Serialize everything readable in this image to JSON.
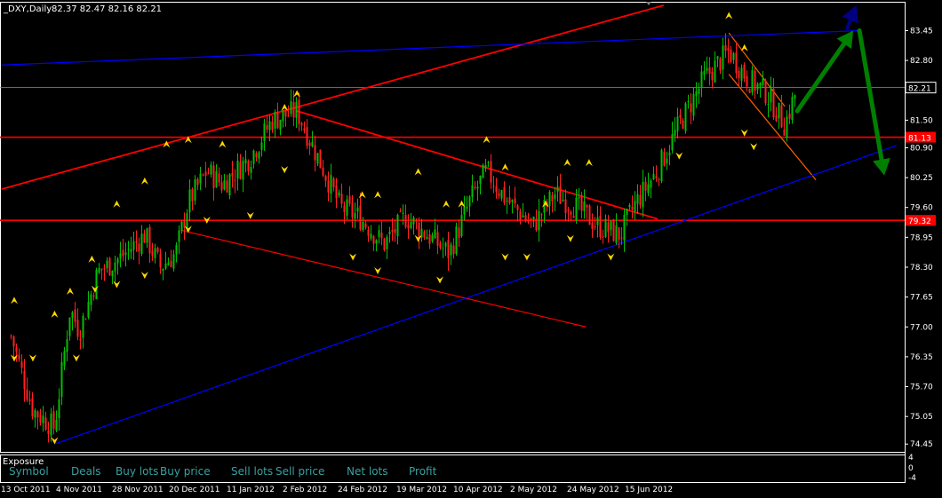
{
  "window": {
    "symbol_label": "_DXY,Daily",
    "ohlc": "82.37 82.47 82.16 82.21"
  },
  "colors": {
    "background": "#000000",
    "grid": "#ffffff",
    "bull_candle": "#00c000",
    "bear_candle": "#ff2020",
    "fractal_marker": "#ffd700",
    "support_resistance": "#ff0000",
    "channel_blue": "#0000ff",
    "forecast_arrow": "#008000",
    "target_arrow": "#000080",
    "price_tag": "#ff0000",
    "exposure_text": "#3aa0a0"
  },
  "price_axis": {
    "ticks": [
      "83.45",
      "82.80",
      "82.15",
      "81.50",
      "80.90",
      "80.25",
      "79.60",
      "78.95",
      "78.30",
      "77.65",
      "77.00",
      "76.35",
      "75.70",
      "75.05",
      "74.45"
    ],
    "current_price": "82.21",
    "level_tags": [
      "81.13",
      "79.32"
    ]
  },
  "date_axis": {
    "ticks": [
      "13 Oct 2011",
      "4 Nov 2011",
      "28 Nov 2011",
      "20 Dec 2011",
      "11 Jan 2012",
      "2 Feb 2012",
      "24 Feb 2012",
      "19 Mar 2012",
      "10 Apr 2012",
      "2 May 2012",
      "24 May 2012",
      "15 Jun 2012"
    ]
  },
  "exposure_panel": {
    "title": "Exposure",
    "columns": [
      "Symbol",
      "Deals",
      "Buy lots",
      "Buy price",
      "Sell lots",
      "Sell price",
      "Net lots",
      "Profit"
    ],
    "scale_ticks": [
      "4",
      "0",
      "-4"
    ]
  },
  "chart_data": {
    "type": "candlestick",
    "symbol": "_DXY",
    "timeframe": "Daily",
    "ylim": [
      74.3,
      84.0
    ],
    "last_ohlc": {
      "open": 82.37,
      "high": 82.47,
      "low": 82.16,
      "close": 82.21
    },
    "close_path": [
      [
        "2011-10-13",
        76.8
      ],
      [
        "2011-10-20",
        75.2
      ],
      [
        "2011-10-27",
        74.8
      ],
      [
        "2011-11-01",
        77.4
      ],
      [
        "2011-11-04",
        76.9
      ],
      [
        "2011-11-10",
        78.2
      ],
      [
        "2011-11-17",
        78.5
      ],
      [
        "2011-11-25",
        79.0
      ],
      [
        "2011-11-30",
        78.3
      ],
      [
        "2011-12-05",
        78.6
      ],
      [
        "2011-12-09",
        79.7
      ],
      [
        "2011-12-15",
        80.4
      ],
      [
        "2011-12-20",
        80.1
      ],
      [
        "2011-12-29",
        80.7
      ],
      [
        "2012-01-05",
        81.5
      ],
      [
        "2012-01-13",
        81.7
      ],
      [
        "2012-01-19",
        80.8
      ],
      [
        "2012-01-27",
        79.6
      ],
      [
        "2012-02-02",
        79.4
      ],
      [
        "2012-02-10",
        78.8
      ],
      [
        "2012-02-17",
        79.4
      ],
      [
        "2012-02-24",
        79.0
      ],
      [
        "2012-03-02",
        78.6
      ],
      [
        "2012-03-09",
        79.8
      ],
      [
        "2012-03-14",
        80.4
      ],
      [
        "2012-03-20",
        79.8
      ],
      [
        "2012-03-29",
        79.2
      ],
      [
        "2012-04-05",
        79.9
      ],
      [
        "2012-04-12",
        79.6
      ],
      [
        "2012-04-19",
        79.2
      ],
      [
        "2012-04-26",
        79.0
      ],
      [
        "2012-05-01",
        79.7
      ],
      [
        "2012-05-08",
        80.4
      ],
      [
        "2012-05-15",
        81.4
      ],
      [
        "2012-05-23",
        82.4
      ],
      [
        "2012-05-31",
        83.0
      ],
      [
        "2012-06-06",
        82.4
      ],
      [
        "2012-06-12",
        82.1
      ],
      [
        "2012-06-18",
        81.4
      ],
      [
        "2012-06-22",
        82.2
      ]
    ],
    "horizontal_levels": [
      81.13,
      79.32
    ],
    "fractal_highs": [
      [
        "2011-10-14",
        77.5
      ],
      [
        "2011-10-27",
        77.2
      ],
      [
        "2011-11-01",
        77.7
      ],
      [
        "2011-11-08",
        78.4
      ],
      [
        "2011-11-16",
        79.6
      ],
      [
        "2011-11-25",
        80.1
      ],
      [
        "2011-12-02",
        80.9
      ],
      [
        "2011-12-09",
        81.0
      ],
      [
        "2011-12-20",
        80.9
      ],
      [
        "2012-01-09",
        81.7
      ],
      [
        "2012-01-13",
        82.0
      ],
      [
        "2012-02-03",
        79.8
      ],
      [
        "2012-02-08",
        79.8
      ],
      [
        "2012-02-21",
        80.3
      ],
      [
        "2012-03-01",
        79.6
      ],
      [
        "2012-03-06",
        79.6
      ],
      [
        "2012-03-14",
        81.0
      ],
      [
        "2012-03-20",
        80.4
      ],
      [
        "2012-04-02",
        79.6
      ],
      [
        "2012-04-09",
        80.5
      ],
      [
        "2012-04-16",
        80.5
      ],
      [
        "2012-05-31",
        83.7
      ],
      [
        "2012-06-05",
        83.0
      ]
    ],
    "fractal_lows": [
      [
        "2011-10-14",
        76.4
      ],
      [
        "2011-10-20",
        76.4
      ],
      [
        "2011-10-27",
        74.6
      ],
      [
        "2011-11-03",
        76.4
      ],
      [
        "2011-11-09",
        77.9
      ],
      [
        "2011-11-16",
        78.0
      ],
      [
        "2011-11-25",
        78.2
      ],
      [
        "2011-12-09",
        79.2
      ],
      [
        "2011-12-15",
        79.4
      ],
      [
        "2011-12-29",
        79.5
      ],
      [
        "2012-01-09",
        80.5
      ],
      [
        "2012-01-31",
        78.6
      ],
      [
        "2012-02-08",
        78.3
      ],
      [
        "2012-02-21",
        79.0
      ],
      [
        "2012-02-28",
        78.1
      ],
      [
        "2012-03-20",
        78.6
      ],
      [
        "2012-03-27",
        78.6
      ],
      [
        "2012-04-10",
        79.0
      ],
      [
        "2012-04-23",
        78.6
      ],
      [
        "2012-05-15",
        80.8
      ],
      [
        "2012-06-05",
        81.3
      ],
      [
        "2012-06-08",
        81.0
      ]
    ],
    "trendlines": [
      {
        "color": "red",
        "from": [
          "2011-10-10",
          80.0
        ],
        "to": [
          "2012-05-10",
          84.0
        ]
      },
      {
        "color": "red",
        "from": [
          "2012-01-13",
          81.7
        ],
        "to": [
          "2012-05-08",
          79.35
        ]
      },
      {
        "color": "red",
        "from": [
          "2011-12-07",
          79.1
        ],
        "to": [
          "2012-04-15",
          77.0
        ]
      },
      {
        "color": "orange",
        "from": [
          "2012-05-31",
          83.4
        ],
        "to": [
          "2012-06-18",
          81.8
        ]
      },
      {
        "color": "orange",
        "from": [
          "2012-05-31",
          82.5
        ],
        "to": [
          "2012-06-28",
          80.2
        ]
      },
      {
        "color": "blue",
        "from": [
          "2011-10-10",
          82.7
        ],
        "to": [
          "2012-07-12",
          83.45
        ]
      },
      {
        "color": "blue",
        "from": [
          "2011-10-27",
          74.45
        ],
        "to": [
          "2012-07-24",
          80.95
        ]
      }
    ],
    "forecast_arrows": [
      {
        "color": "green",
        "from": [
          "2012-06-22",
          81.7
        ],
        "to": [
          "2012-07-10",
          83.45
        ]
      },
      {
        "color": "green",
        "from": [
          "2012-07-12",
          83.45
        ],
        "to": [
          "2012-07-20",
          80.3
        ]
      },
      {
        "color": "navy",
        "from": [
          "2012-07-08",
          83.5
        ],
        "to": [
          "2012-07-11",
          84.0
        ]
      }
    ]
  }
}
